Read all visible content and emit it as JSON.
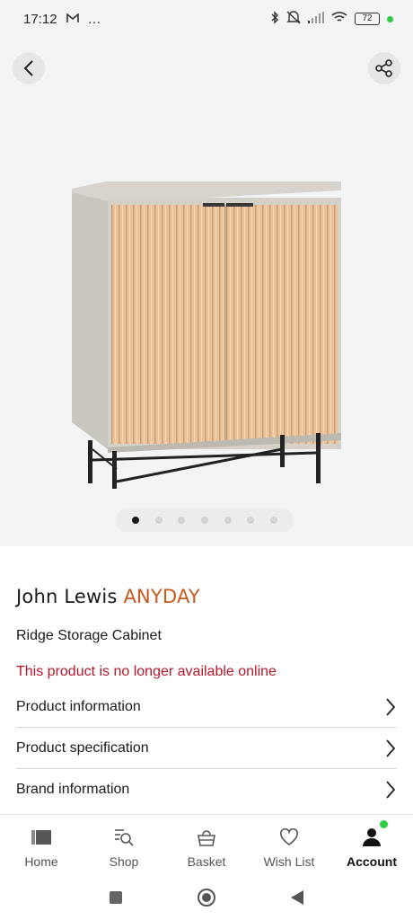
{
  "status_bar": {
    "time": "17:12",
    "extra": "…",
    "battery": "72"
  },
  "hero": {
    "image_count": 7,
    "active_image": 1
  },
  "product": {
    "brand_main": "John Lewis",
    "brand_sub": "ANYDAY",
    "name": "Ridge Storage Cabinet",
    "availability": "This product is no longer available online"
  },
  "info_rows": [
    {
      "label": "Product information"
    },
    {
      "label": "Product specification"
    },
    {
      "label": "Brand information"
    }
  ],
  "bottom_nav": {
    "items": [
      {
        "label": "Home",
        "icon": "home-icon"
      },
      {
        "label": "Shop",
        "icon": "shop-search-icon"
      },
      {
        "label": "Basket",
        "icon": "basket-icon"
      },
      {
        "label": "Wish List",
        "icon": "heart-icon"
      },
      {
        "label": "Account",
        "icon": "account-icon"
      }
    ],
    "active": "Account"
  },
  "colors": {
    "brand_accent": "#c65a1e",
    "error": "#b5172b",
    "notification": "#2ecc40"
  }
}
